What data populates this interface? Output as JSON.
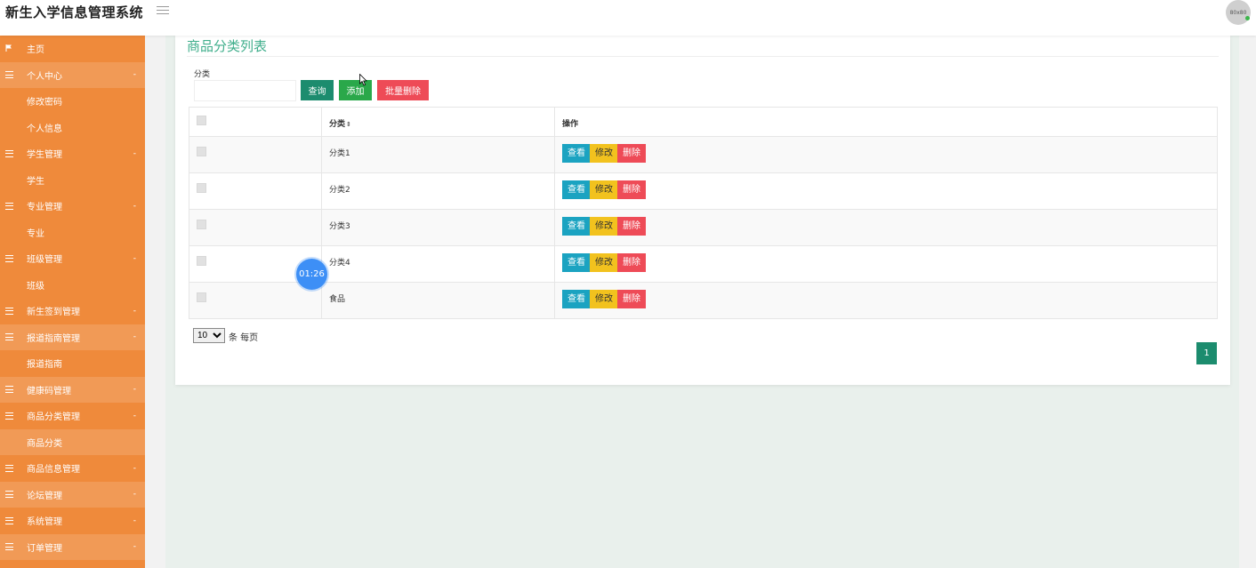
{
  "header": {
    "app_title": "新生入学信息管理系统",
    "avatar_text": "80x80"
  },
  "sidebar": {
    "items": [
      {
        "label": "主页",
        "type": "home"
      },
      {
        "label": "个人中心",
        "type": "group",
        "arrow": "-"
      },
      {
        "label": "修改密码",
        "type": "sub"
      },
      {
        "label": "个人信息",
        "type": "sub"
      },
      {
        "label": "学生管理",
        "type": "group",
        "arrow": "-"
      },
      {
        "label": "学生",
        "type": "sub"
      },
      {
        "label": "专业管理",
        "type": "group",
        "arrow": "-"
      },
      {
        "label": "专业",
        "type": "sub"
      },
      {
        "label": "班级管理",
        "type": "group",
        "arrow": "-"
      },
      {
        "label": "班级",
        "type": "sub"
      },
      {
        "label": "新生签到管理",
        "type": "group",
        "arrow": "-"
      },
      {
        "label": "报道指南管理",
        "type": "group",
        "arrow": "-"
      },
      {
        "label": "报道指南",
        "type": "sub"
      },
      {
        "label": "健康码管理",
        "type": "group",
        "arrow": "-"
      },
      {
        "label": "商品分类管理",
        "type": "group",
        "arrow": "-"
      },
      {
        "label": "商品分类",
        "type": "sub"
      },
      {
        "label": "商品信息管理",
        "type": "group",
        "arrow": "-"
      },
      {
        "label": "论坛管理",
        "type": "group",
        "arrow": "-"
      },
      {
        "label": "系统管理",
        "type": "group",
        "arrow": "-"
      },
      {
        "label": "订单管理",
        "type": "group",
        "arrow": "-"
      }
    ]
  },
  "page": {
    "title": "商品分类列表",
    "filter_label": "分类",
    "filter_value": "",
    "btn_query": "查询",
    "btn_add": "添加",
    "btn_batch_delete": "批量删除"
  },
  "table": {
    "headers": {
      "category": "分类",
      "sort_icon": "⇕",
      "actions": "操作"
    },
    "rows": [
      {
        "category": "分类1"
      },
      {
        "category": "分类2"
      },
      {
        "category": "分类3"
      },
      {
        "category": "分类4"
      },
      {
        "category": "食品"
      }
    ],
    "action_labels": {
      "view": "查看",
      "edit": "修改",
      "delete": "删除"
    }
  },
  "pager": {
    "page_size": "10",
    "page_size_suffix": "条 每页",
    "current_page": "1"
  },
  "overlay": {
    "timer": "01:26"
  },
  "colors": {
    "sidebar": "#ef8a3b",
    "accent_green": "#1c8c6e",
    "add_green": "#2aa84a",
    "danger": "#ee4b57",
    "info": "#1ba3c1",
    "warning": "#f2c21e",
    "title_green": "#3fae8b"
  }
}
